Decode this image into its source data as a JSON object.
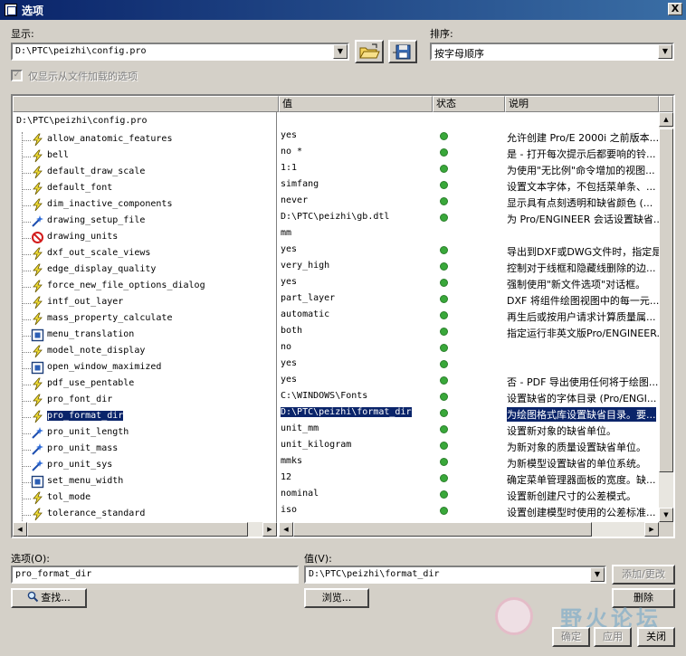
{
  "window": {
    "title": "选项",
    "close_label": "X"
  },
  "display": {
    "label": "显示:",
    "value": "D:\\PTC\\peizhi\\config.pro"
  },
  "sort": {
    "label": "排序:",
    "value": "按字母顺序"
  },
  "filter_checkbox": {
    "label": "仅显示从文件加载的选项",
    "checked": true,
    "enabled": false
  },
  "table": {
    "headers": {
      "option": "",
      "value": "值",
      "status": "状态",
      "description": "说明"
    },
    "root": "D:\\PTC\\peizhi\\config.pro",
    "rows": [
      {
        "name": "allow_anatomic_features",
        "icon": "lightning-icon",
        "value": "yes",
        "status": "green",
        "description": "允许创建 Pro/E 2000i 之前版本..."
      },
      {
        "name": "bell",
        "icon": "lightning-icon",
        "value": "no *",
        "status": "green",
        "description": "是 - 打开每次提示后都要响的铃..."
      },
      {
        "name": "default_draw_scale",
        "icon": "lightning-icon",
        "value": "1:1",
        "status": "green",
        "description": "为使用\"无比例\"命令增加的视图..."
      },
      {
        "name": "default_font",
        "icon": "lightning-icon",
        "value": "simfang",
        "status": "green",
        "description": "设置文本字体，不包括菜单条、..."
      },
      {
        "name": "dim_inactive_components",
        "icon": "lightning-icon",
        "value": "never",
        "status": "green",
        "description": "显示具有点刻透明和缺省颜色 (..."
      },
      {
        "name": "drawing_setup_file",
        "icon": "wand-icon",
        "value": "D:\\PTC\\peizhi\\gb.dtl",
        "status": "green",
        "description": "为 Pro/ENGINEER 会话设置缺省..."
      },
      {
        "name": "drawing_units",
        "icon": "prohibited-icon",
        "value": "mm",
        "status": "",
        "description": ""
      },
      {
        "name": "dxf_out_scale_views",
        "icon": "lightning-icon",
        "value": "yes",
        "status": "green",
        "description": "导出到DXF或DWG文件时，指定是..."
      },
      {
        "name": "edge_display_quality",
        "icon": "lightning-icon",
        "value": "very_high",
        "status": "green",
        "description": "控制对于线框和隐藏线删除的边..."
      },
      {
        "name": "force_new_file_options_dialog",
        "icon": "lightning-icon",
        "value": "yes",
        "status": "green",
        "description": "强制使用\"新文件选项\"对话框。"
      },
      {
        "name": "intf_out_layer",
        "icon": "lightning-icon",
        "value": "part_layer",
        "status": "green",
        "description": "DXF 将组件绘图视图中的每一元..."
      },
      {
        "name": "mass_property_calculate",
        "icon": "lightning-icon",
        "value": "automatic",
        "status": "green",
        "description": "再生后或按用户请求计算质量属..."
      },
      {
        "name": "menu_translation",
        "icon": "box-icon",
        "value": "both",
        "status": "green",
        "description": "指定运行非英文版Pro/ENGINEER..."
      },
      {
        "name": "model_note_display",
        "icon": "lightning-icon",
        "value": "no",
        "status": "green",
        "description": ""
      },
      {
        "name": "open_window_maximized",
        "icon": "box-icon",
        "value": "yes",
        "status": "green",
        "description": ""
      },
      {
        "name": "pdf_use_pentable",
        "icon": "lightning-icon",
        "value": "yes",
        "status": "green",
        "description": "否 - PDF 导出使用任何将于绘图..."
      },
      {
        "name": "pro_font_dir",
        "icon": "lightning-icon",
        "value": "C:\\WINDOWS\\Fonts",
        "status": "green",
        "description": "设置缺省的字体目录 (Pro/ENGI..."
      },
      {
        "name": "pro_format_dir",
        "icon": "lightning-icon",
        "value": "D:\\PTC\\peizhi\\format_dir",
        "status": "green",
        "description": "为绘图格式库设置缺省目录。要...",
        "selected": true
      },
      {
        "name": "pro_unit_length",
        "icon": "wand-icon",
        "value": "unit_mm",
        "status": "green",
        "description": "设置新对象的缺省单位。"
      },
      {
        "name": "pro_unit_mass",
        "icon": "wand-icon",
        "value": "unit_kilogram",
        "status": "green",
        "description": "为新对象的质量设置缺省单位。"
      },
      {
        "name": "pro_unit_sys",
        "icon": "wand-icon",
        "value": "mmks",
        "status": "green",
        "description": "为新模型设置缺省的单位系统。"
      },
      {
        "name": "set_menu_width",
        "icon": "box-icon",
        "value": "12",
        "status": "green",
        "description": "确定菜单管理器面板的宽度。缺..."
      },
      {
        "name": "tol_mode",
        "icon": "lightning-icon",
        "value": "nominal",
        "status": "green",
        "description": "设置新创建尺寸的公差模式。"
      },
      {
        "name": "tolerance_standard",
        "icon": "lightning-icon",
        "value": "iso",
        "status": "green",
        "description": "设置创建模型时使用的公差标准..."
      }
    ]
  },
  "option_field": {
    "label": "选项(O):",
    "value": "pro_format_dir"
  },
  "value_field": {
    "label": "值(V):",
    "value": "D:\\PTC\\peizhi\\format_dir"
  },
  "buttons": {
    "find": "查找...",
    "browse": "浏览...",
    "add_change": "添加/更改",
    "delete": "删除",
    "ok": "确定",
    "apply": "应用",
    "close": "关闭"
  },
  "watermark": {
    "text": "野火论坛"
  }
}
